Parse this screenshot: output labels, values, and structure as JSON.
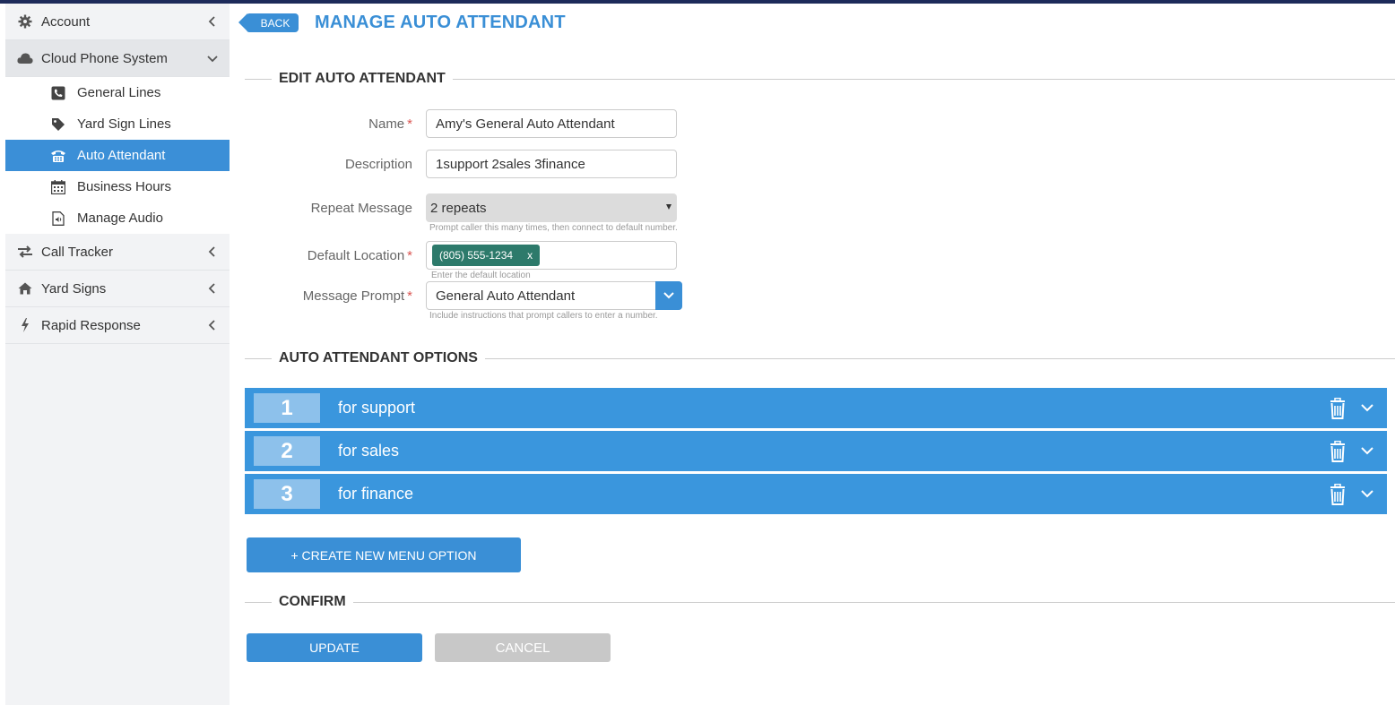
{
  "sidebar": {
    "items": [
      {
        "label": "Account",
        "icon": "gear-icon"
      },
      {
        "label": "Cloud Phone System",
        "icon": "cloud-icon"
      },
      {
        "label": "Call Tracker",
        "icon": "exchange-icon"
      },
      {
        "label": "Yard Signs",
        "icon": "home-icon"
      },
      {
        "label": "Rapid Response",
        "icon": "bolt-icon"
      }
    ],
    "sub_items": [
      {
        "label": "General Lines",
        "icon": "phone-square-icon"
      },
      {
        "label": "Yard Sign Lines",
        "icon": "tag-icon"
      },
      {
        "label": "Auto Attendant",
        "icon": "fax-phone-icon",
        "active": true
      },
      {
        "label": "Business Hours",
        "icon": "calendar-icon"
      },
      {
        "label": "Manage Audio",
        "icon": "audio-file-icon"
      }
    ]
  },
  "header": {
    "back_label": "BACK",
    "title": "MANAGE AUTO ATTENDANT"
  },
  "edit_section": {
    "heading": "EDIT AUTO ATTENDANT",
    "name_label": "Name",
    "name_value": "Amy's General Auto Attendant",
    "description_label": "Description",
    "description_value": "1support 2sales 3finance",
    "repeat_label": "Repeat Message",
    "repeat_value": "2 repeats",
    "repeat_help": "Prompt caller this many times, then connect to default number.",
    "location_label": "Default Location",
    "location_tag": "(805) 555-1234",
    "location_tag_remove": "x",
    "location_help": "Enter the default location",
    "prompt_label": "Message Prompt",
    "prompt_value": "General Auto Attendant",
    "prompt_help": "Include instructions that prompt callers to enter a number.",
    "required_mark": "*"
  },
  "options_section": {
    "heading": "AUTO ATTENDANT OPTIONS",
    "options": [
      {
        "key": "1",
        "label": "for support"
      },
      {
        "key": "2",
        "label": "for sales"
      },
      {
        "key": "3",
        "label": "for finance"
      }
    ],
    "create_label": "+ CREATE NEW MENU OPTION"
  },
  "confirm_section": {
    "heading": "CONFIRM",
    "update_label": "UPDATE",
    "cancel_label": "CANCEL"
  },
  "colors": {
    "accent": "#3a8fd6",
    "option_row": "#3a96dd",
    "tag": "#2d7a6b",
    "topbar": "#1d2b5a"
  }
}
